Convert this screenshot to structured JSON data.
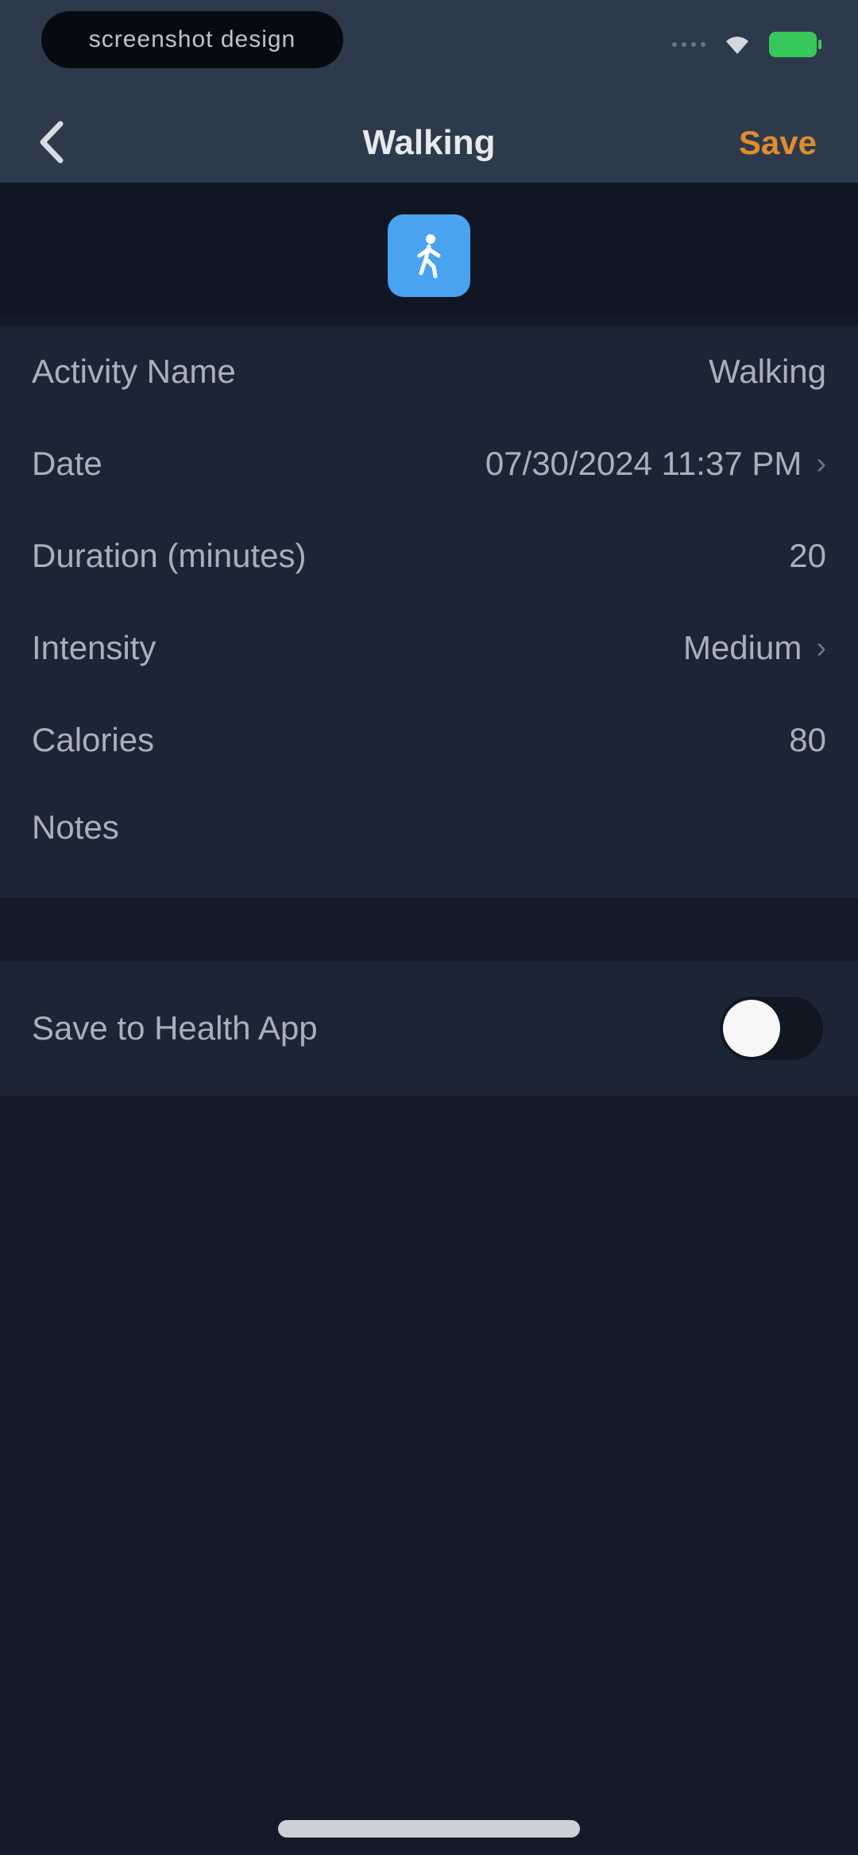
{
  "status": {
    "left_pill_text": "screenshot design",
    "signal": "cellular-signal-icon",
    "wifi": "wifi-icon",
    "battery": "battery-icon",
    "battery_color": "#38c75a"
  },
  "nav": {
    "back_icon": "chevron-left-icon",
    "title": "Walking",
    "save_label": "Save",
    "save_color": "#e08c2e"
  },
  "activity_icon": {
    "name": "walking-figure-icon",
    "color": "#4aa3ef"
  },
  "form": {
    "activity_name": {
      "label": "Activity Name",
      "value": "Walking"
    },
    "date": {
      "label": "Date",
      "value": "07/30/2024 11:37 PM"
    },
    "duration": {
      "label": "Duration (minutes)",
      "value": "20"
    },
    "intensity": {
      "label": "Intensity",
      "value": "Medium"
    },
    "calories": {
      "label": "Calories",
      "value": "80"
    },
    "notes": {
      "label": "Notes",
      "value": ""
    }
  },
  "health": {
    "label": "Save to Health App",
    "enabled": false
  }
}
